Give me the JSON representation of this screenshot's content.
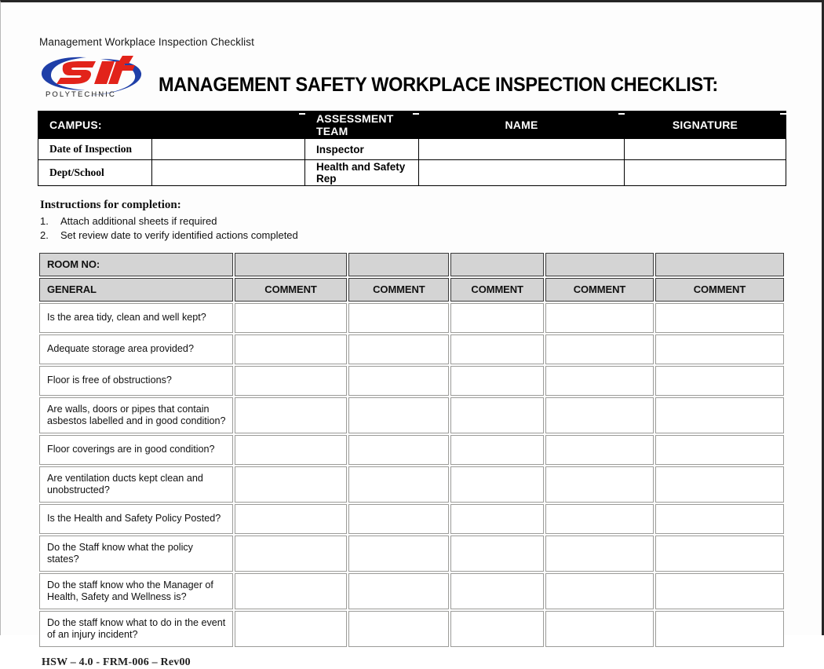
{
  "document": {
    "kicker": "Management Workplace Inspection Checklist",
    "title": "MANAGEMENT SAFETY WORKPLACE INSPECTION CHECKLIST:",
    "footer": "HSW – 4.0 - FRM-006 – Rev00"
  },
  "logo": {
    "wordmark": "Sait",
    "subtext": "POLYTECHNIC",
    "red": "#e2231a",
    "blue": "#1f3fa8"
  },
  "campus_table": {
    "headers": {
      "campus": "CAMPUS:",
      "campus_value": "",
      "assessment_team": "ASSESSMENT TEAM",
      "name": "NAME",
      "signature": "SIGNATURE"
    },
    "rows": [
      {
        "label": "Date of Inspection",
        "label_value": "",
        "role": "Inspector",
        "name": "",
        "signature": ""
      },
      {
        "label": "Dept/School",
        "label_value": "",
        "role": "Health and Safety Rep",
        "name": "",
        "signature": ""
      }
    ]
  },
  "instructions": {
    "title": "Instructions for completion:",
    "items": [
      {
        "num": "1.",
        "text": "Attach additional sheets if required"
      },
      {
        "num": "2.",
        "text": "Set review date to verify identified actions completed"
      }
    ]
  },
  "checklist": {
    "room_no_label": "ROOM NO:",
    "room_no_values": [
      "",
      "",
      "",
      "",
      ""
    ],
    "general_label": "GENERAL",
    "comment_headers": [
      "COMMENT",
      "COMMENT",
      "COMMENT",
      "COMMENT",
      "COMMENT"
    ],
    "questions": [
      {
        "text": "Is the area tidy, clean and well kept?",
        "tall": false
      },
      {
        "text": "Adequate storage area provided?",
        "tall": false
      },
      {
        "text": "Floor is free of obstructions?",
        "tall": false
      },
      {
        "text": "Are walls, doors or pipes that contain asbestos labelled and in good condition?",
        "tall": true
      },
      {
        "text": "Floor coverings are in good condition?",
        "tall": false
      },
      {
        "text": "Are ventilation ducts kept clean and unobstructed?",
        "tall": true
      },
      {
        "text": "Is the Health and Safety Policy Posted?",
        "tall": false
      },
      {
        "text": "Do the Staff know what the policy states?",
        "tall": true
      },
      {
        "text": "Do the staff know who the Manager of Health, Safety and Wellness is?",
        "tall": true
      },
      {
        "text": "Do the staff know what to do in the event of an injury incident?",
        "tall": true
      }
    ]
  }
}
